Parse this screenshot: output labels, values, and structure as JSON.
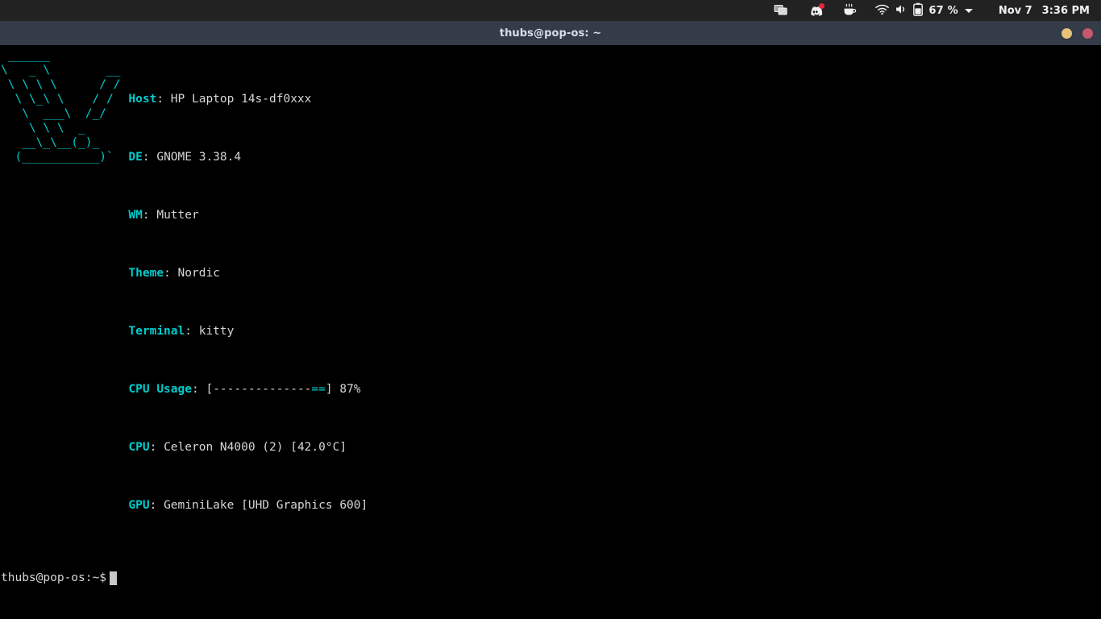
{
  "topbar": {
    "tray_icons": [
      {
        "name": "screen-share-icon",
        "label": "Screen Share"
      },
      {
        "name": "discord-icon",
        "label": "Discord",
        "badge": true
      },
      {
        "name": "coffee-cup-icon",
        "label": "Caffeine"
      }
    ],
    "status": {
      "wifi_label": "Wi-Fi",
      "volume_label": "Volume",
      "battery_label": "Battery",
      "battery_percent": "67 %",
      "menu_chevron": "chevron-down-icon"
    },
    "clock": {
      "date": "Nov 7",
      "time": "3:36 PM"
    }
  },
  "window": {
    "title": "thubs@pop-os: ~",
    "controls": {
      "minimize_label": "Minimize",
      "close_label": "Close"
    },
    "colors": {
      "titlebar_bg": "#343b49",
      "minimize": "#e6c37a",
      "close": "#c4596b"
    }
  },
  "terminal": {
    "colors": {
      "background": "#000000",
      "foreground": "#d6d6d6",
      "accent_cyan": "#00cdcd"
    },
    "ascii_art": " ______\n\\   _ \\        __\n \\ \\ \\ \\      / /\n  \\ \\_\\ \\    / /\n   \\  ___\\  /_/\n    \\ \\ \\  _\n   __\\_\\__(_)_\n  (___________)`",
    "info": [
      {
        "key": "Host",
        "value": "HP Laptop 14s-df0xxx"
      },
      {
        "key": "DE",
        "value": "GNOME 3.38.4"
      },
      {
        "key": "WM",
        "value": "Mutter"
      },
      {
        "key": "Theme",
        "value": "Nordic"
      },
      {
        "key": "Terminal",
        "value": "kitty"
      },
      {
        "key": "CPU Usage",
        "value": "[--------------==] 87%",
        "bar": {
          "prefix": "[",
          "free": "--------------",
          "used": "==",
          "suffix": "]",
          "percent": "87%"
        }
      },
      {
        "key": "CPU",
        "value": "Celeron N4000 (2) [42.0°C]"
      },
      {
        "key": "GPU",
        "value": "GeminiLake [UHD Graphics 600]"
      }
    ],
    "prompt": "thubs@pop-os:~$",
    "command": ""
  }
}
